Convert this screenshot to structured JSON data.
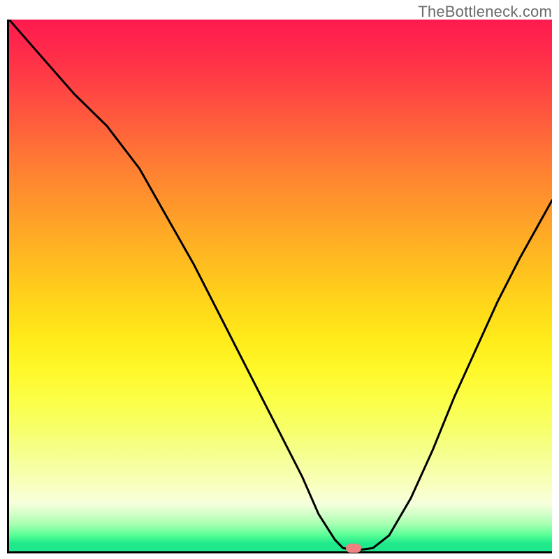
{
  "watermark": "TheBottleneck.com",
  "chart_data": {
    "type": "line",
    "title": "",
    "xlabel": "",
    "ylabel": "",
    "xlim": [
      0,
      100
    ],
    "ylim": [
      0,
      100
    ],
    "grid": false,
    "curve_description": "V-shaped bottleneck curve on red-to-green vertical gradient",
    "series": [
      {
        "name": "bottleneck-curve",
        "x": [
          0,
          6,
          12,
          18,
          24,
          29,
          34,
          38,
          42,
          46,
          50,
          54,
          57,
          60,
          61.5,
          64,
          67,
          70,
          74,
          78,
          82,
          86,
          90,
          94,
          100
        ],
        "y": [
          100,
          93,
          86,
          80,
          72,
          63,
          54,
          46,
          38,
          30,
          22,
          14,
          7,
          2.2,
          0.6,
          0.2,
          0.6,
          3,
          10,
          19,
          29,
          38,
          47,
          55,
          66
        ]
      }
    ],
    "marker": {
      "x": 63.5,
      "y": 0.6,
      "color": "#ef8181",
      "shape": "pill"
    },
    "gradient_stops": [
      {
        "pos": 0,
        "color": "#ff1a4f"
      },
      {
        "pos": 0.5,
        "color": "#ffd81a"
      },
      {
        "pos": 0.8,
        "color": "#f7ff6a"
      },
      {
        "pos": 1.0,
        "color": "#1fe88c"
      }
    ]
  }
}
